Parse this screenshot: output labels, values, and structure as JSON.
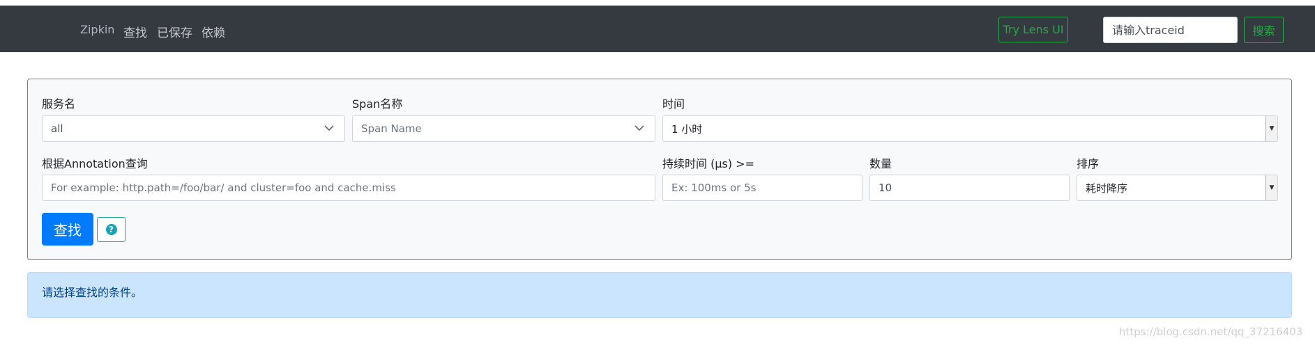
{
  "navbar": {
    "brand": "Zipkin",
    "links": [
      "查找",
      "已保存",
      "依赖"
    ],
    "lens_button": "Try Lens UI",
    "traceid_placeholder": "请输入traceid",
    "search_button": "搜索"
  },
  "form": {
    "service_label": "服务名",
    "service_value": "all",
    "span_label": "Span名称",
    "span_value": "Span Name",
    "time_label": "时间",
    "time_value": "1 小时",
    "annotation_label": "根据Annotation查询",
    "annotation_placeholder": "For example: http.path=/foo/bar/ and cluster=foo and cache.miss",
    "duration_label": "持续时间 (μs) >=",
    "duration_placeholder": "Ex: 100ms or 5s",
    "limit_label": "数量",
    "limit_value": "10",
    "sort_label": "排序",
    "sort_value": "耗时降序",
    "find_button": "查找",
    "help_icon": "?"
  },
  "alert": {
    "text": "请选择查找的条件。"
  },
  "watermark": "https://blog.csdn.net/qq_37216403",
  "colors": {
    "navbar_bg": "#343a40",
    "success": "#28a745",
    "primary": "#007bff",
    "info": "#17a2b8",
    "alert_bg": "#cce5ff"
  }
}
